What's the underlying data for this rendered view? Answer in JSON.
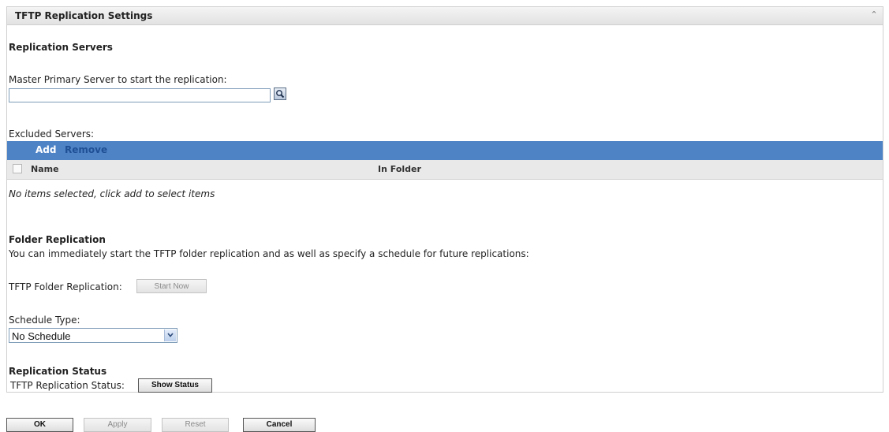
{
  "panel": {
    "title": "TFTP Replication Settings",
    "collapse_icon": "double-chevron-up-icon"
  },
  "replication_servers": {
    "section_title": "Replication Servers",
    "master_label": "Master Primary Server to start the replication:",
    "master_value": "",
    "browse_icon": "magnifier-icon",
    "excluded_label": "Excluded Servers:",
    "toolbar": {
      "add": "Add",
      "remove": "Remove"
    },
    "columns": [
      "Name",
      "In Folder"
    ],
    "empty_message": "No items selected, click add to select items"
  },
  "folder_replication": {
    "section_title": "Folder Replication",
    "description": "You can immediately start the TFTP folder replication and as well as specify a schedule for future replications:",
    "tftp_label": "TFTP Folder Replication:",
    "start_now": "Start Now",
    "schedule_label": "Schedule Type:",
    "schedule_value": "No Schedule"
  },
  "replication_status": {
    "section_title": "Replication Status",
    "status_label": "TFTP Replication Status:",
    "show_status": "Show Status"
  },
  "footer": {
    "ok": "OK",
    "apply": "Apply",
    "reset": "Reset",
    "cancel": "Cancel"
  },
  "colors": {
    "toolbar_bg": "#4e83c6",
    "add_text": "#ffffff",
    "remove_text": "#1f4f94"
  }
}
